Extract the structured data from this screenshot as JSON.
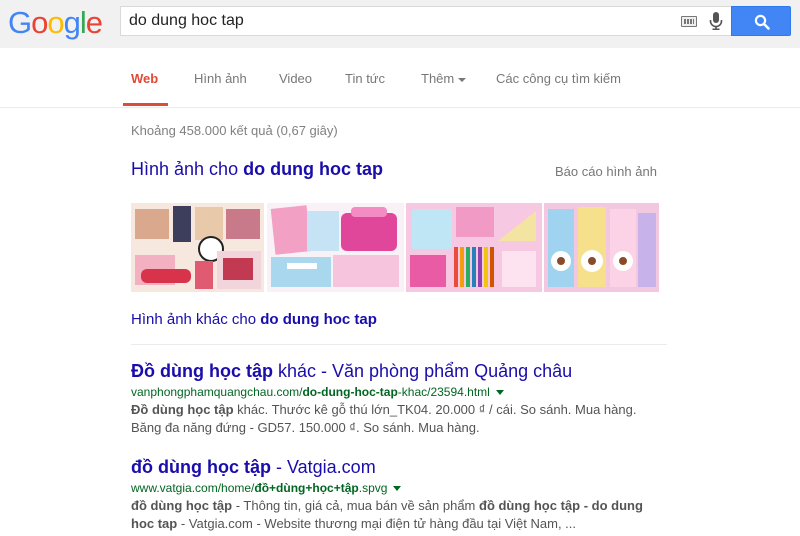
{
  "header": {
    "logo_letters": [
      "G",
      "o",
      "o",
      "g",
      "l",
      "e"
    ],
    "logo_colors": [
      "#4285f4",
      "#ea4335",
      "#fbbc05",
      "#4285f4",
      "#34a853",
      "#ea4335"
    ],
    "search_query": "do dung hoc tap",
    "keyboard_icon": "keyboard-icon",
    "mic_icon": "microphone-icon",
    "search_icon": "magnifier-icon"
  },
  "tabs": [
    {
      "label": "Web",
      "active": true
    },
    {
      "label": "Hình ảnh",
      "active": false
    },
    {
      "label": "Video",
      "active": false
    },
    {
      "label": "Tin tức",
      "active": false
    },
    {
      "label": "Thêm",
      "active": false
    },
    {
      "label": "Các công cụ tìm kiếm",
      "active": false
    }
  ],
  "stats": "Khoảng 458.000 kết quả (0,67 giây)",
  "images": {
    "heading_prefix": "Hình ảnh cho ",
    "heading_query": "do dung hoc tap",
    "report": "Báo cáo hình ảnh",
    "more_prefix": "Hình ảnh khác cho ",
    "more_query": "do dung hoc tap"
  },
  "results": [
    {
      "title_bold": "Đồ dùng học tập",
      "title_rest": " khác - Văn phòng phẩm Quảng châu",
      "url_pre": "vanphongphamquangchau.com/",
      "url_bold": "do-dung-hoc-tap",
      "url_post": "-khac/23594.html",
      "snippet_bold1": "Đồ dùng học tập",
      "snippet_rest1": " khác. Thước kê gỗ thú lớn_TK04. 20.000 ₫ / cái. So sánh. Mua hàng. Băng đa năng đứng - GD57. 150.000 ₫. So sánh. Mua hàng."
    },
    {
      "title_bold": "đồ dùng học tập",
      "title_rest": " - Vatgia.com",
      "url_pre": "www.vatgia.com/home/",
      "url_bold": "đồ+dùng+học+tập",
      "url_post": ".spvg",
      "snippet_bold1": "đồ dùng học tập",
      "snippet_mid": " - Thông tin, giá cả, mua bán về sản phẩm ",
      "snippet_bold2": "đồ dùng học tập - do dung hoc tap",
      "snippet_rest1": " - Vatgia.com - Website thương mại điện tử hàng đầu tại Việt Nam, ..."
    }
  ]
}
